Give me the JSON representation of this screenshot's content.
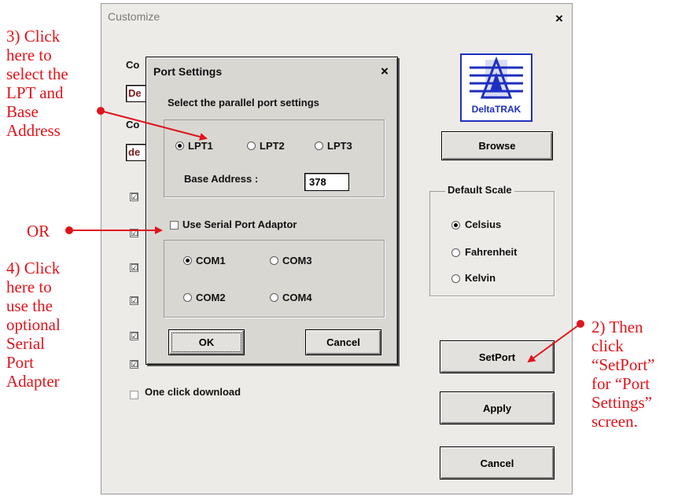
{
  "annotations": {
    "step3": "3) Click\nhere to\nselect the\nLPT and\nBase\nAddress",
    "or": "OR",
    "step4": "4) Click\nhere to\nuse the\noptional\nSerial\nPort\nAdapter",
    "step2": "2) Then\nclick\n“SetPort”\nfor “Port\nSettings”\nscreen."
  },
  "customize": {
    "title": "Customize",
    "close": "×",
    "label1": "Co",
    "field1": "De",
    "label2": "Co",
    "field2": "de",
    "checks": [
      "☑",
      "☑",
      "☑",
      "☑",
      "☑",
      "☑"
    ],
    "one_click": "One click download",
    "logo_text": "DeltaTRAK",
    "browse": "Browse",
    "default_scale": "Default Scale",
    "scale_options": [
      "Celsius",
      "Fahrenheit",
      "Kelvin"
    ],
    "scale_selected": "Celsius",
    "setport": "SetPort",
    "apply": "Apply",
    "cancel": "Cancel"
  },
  "port_settings": {
    "title": "Port Settings",
    "close": "×",
    "instruction": "Select the parallel port settings",
    "lpt_options": [
      "LPT1",
      "LPT2",
      "LPT3"
    ],
    "lpt_selected": "LPT1",
    "base_address_label": "Base Address :",
    "base_address_value": "378",
    "serial_label": "Use Serial Port Adaptor",
    "serial_checked": false,
    "com_options": [
      "COM1",
      "COM3",
      "COM2",
      "COM4"
    ],
    "com_selected": "COM1",
    "ok": "OK",
    "cancel": "Cancel"
  },
  "colors": {
    "annotation": "#e1131b",
    "dialog_bg": "#ecebe8",
    "logo_blue": "#1f2fbf"
  }
}
